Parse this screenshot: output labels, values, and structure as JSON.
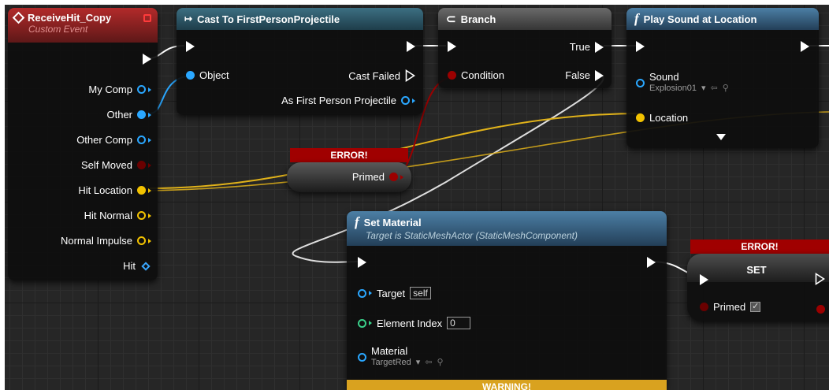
{
  "receive_hit": {
    "title": "ReceiveHit_Copy",
    "subtitle": "Custom Event",
    "pins": [
      {
        "label": "My Comp"
      },
      {
        "label": "Other"
      },
      {
        "label": "Other Comp"
      },
      {
        "label": "Self Moved"
      },
      {
        "label": "Hit Location"
      },
      {
        "label": "Hit Normal"
      },
      {
        "label": "Normal Impulse"
      },
      {
        "label": "Hit"
      }
    ]
  },
  "cast_node": {
    "title": "Cast To FirstPersonProjectile",
    "object_label": "Object",
    "cast_failed_label": "Cast Failed",
    "as_label": "As First Person Projectile"
  },
  "branch_node": {
    "title": "Branch",
    "condition_label": "Condition",
    "true_label": "True",
    "false_label": "False"
  },
  "play_sound_node": {
    "title": "Play Sound at Location",
    "sound_label": "Sound",
    "sound_asset": "Explosion01",
    "location_label": "Location"
  },
  "primed_getter": {
    "error_label": "ERROR!",
    "label": "Primed"
  },
  "set_material_node": {
    "title": "Set Material",
    "subtitle": "Target is StaticMeshActor (StaticMeshComponent)",
    "target_label": "Target",
    "target_value": "self",
    "element_index_label": "Element Index",
    "element_index_value": "0",
    "material_label": "Material",
    "material_asset": "TargetRed",
    "warning_label": "WARNING!"
  },
  "set_node": {
    "error_label": "ERROR!",
    "title": "SET",
    "primed_label": "Primed"
  },
  "colors": {
    "exec": "#ffffff",
    "object": "#2aa7ff",
    "bool": "#9b0000",
    "vector": "#f2c200",
    "struct": "#3aa7ff",
    "int": "#3ad08a",
    "error": "#a00000",
    "warning": "#d9a21f"
  }
}
